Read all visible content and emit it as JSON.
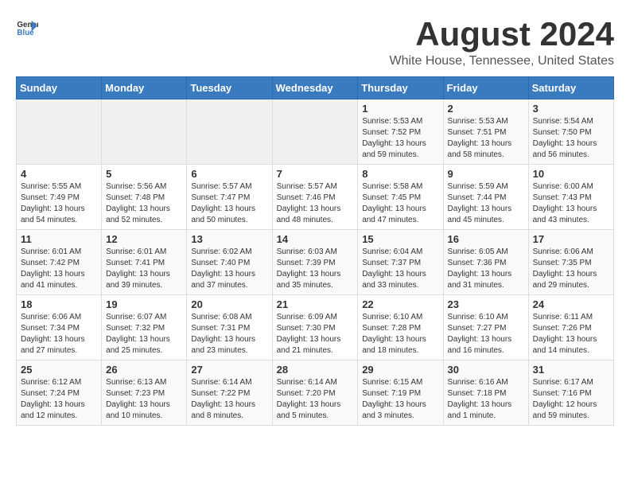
{
  "header": {
    "logo_general": "General",
    "logo_blue": "Blue",
    "main_title": "August 2024",
    "subtitle": "White House, Tennessee, United States"
  },
  "calendar": {
    "days_of_week": [
      "Sunday",
      "Monday",
      "Tuesday",
      "Wednesday",
      "Thursday",
      "Friday",
      "Saturday"
    ],
    "weeks": [
      [
        {
          "day": "",
          "info": ""
        },
        {
          "day": "",
          "info": ""
        },
        {
          "day": "",
          "info": ""
        },
        {
          "day": "",
          "info": ""
        },
        {
          "day": "1",
          "info": "Sunrise: 5:53 AM\nSunset: 7:52 PM\nDaylight: 13 hours\nand 59 minutes."
        },
        {
          "day": "2",
          "info": "Sunrise: 5:53 AM\nSunset: 7:51 PM\nDaylight: 13 hours\nand 58 minutes."
        },
        {
          "day": "3",
          "info": "Sunrise: 5:54 AM\nSunset: 7:50 PM\nDaylight: 13 hours\nand 56 minutes."
        }
      ],
      [
        {
          "day": "4",
          "info": "Sunrise: 5:55 AM\nSunset: 7:49 PM\nDaylight: 13 hours\nand 54 minutes."
        },
        {
          "day": "5",
          "info": "Sunrise: 5:56 AM\nSunset: 7:48 PM\nDaylight: 13 hours\nand 52 minutes."
        },
        {
          "day": "6",
          "info": "Sunrise: 5:57 AM\nSunset: 7:47 PM\nDaylight: 13 hours\nand 50 minutes."
        },
        {
          "day": "7",
          "info": "Sunrise: 5:57 AM\nSunset: 7:46 PM\nDaylight: 13 hours\nand 48 minutes."
        },
        {
          "day": "8",
          "info": "Sunrise: 5:58 AM\nSunset: 7:45 PM\nDaylight: 13 hours\nand 47 minutes."
        },
        {
          "day": "9",
          "info": "Sunrise: 5:59 AM\nSunset: 7:44 PM\nDaylight: 13 hours\nand 45 minutes."
        },
        {
          "day": "10",
          "info": "Sunrise: 6:00 AM\nSunset: 7:43 PM\nDaylight: 13 hours\nand 43 minutes."
        }
      ],
      [
        {
          "day": "11",
          "info": "Sunrise: 6:01 AM\nSunset: 7:42 PM\nDaylight: 13 hours\nand 41 minutes."
        },
        {
          "day": "12",
          "info": "Sunrise: 6:01 AM\nSunset: 7:41 PM\nDaylight: 13 hours\nand 39 minutes."
        },
        {
          "day": "13",
          "info": "Sunrise: 6:02 AM\nSunset: 7:40 PM\nDaylight: 13 hours\nand 37 minutes."
        },
        {
          "day": "14",
          "info": "Sunrise: 6:03 AM\nSunset: 7:39 PM\nDaylight: 13 hours\nand 35 minutes."
        },
        {
          "day": "15",
          "info": "Sunrise: 6:04 AM\nSunset: 7:37 PM\nDaylight: 13 hours\nand 33 minutes."
        },
        {
          "day": "16",
          "info": "Sunrise: 6:05 AM\nSunset: 7:36 PM\nDaylight: 13 hours\nand 31 minutes."
        },
        {
          "day": "17",
          "info": "Sunrise: 6:06 AM\nSunset: 7:35 PM\nDaylight: 13 hours\nand 29 minutes."
        }
      ],
      [
        {
          "day": "18",
          "info": "Sunrise: 6:06 AM\nSunset: 7:34 PM\nDaylight: 13 hours\nand 27 minutes."
        },
        {
          "day": "19",
          "info": "Sunrise: 6:07 AM\nSunset: 7:32 PM\nDaylight: 13 hours\nand 25 minutes."
        },
        {
          "day": "20",
          "info": "Sunrise: 6:08 AM\nSunset: 7:31 PM\nDaylight: 13 hours\nand 23 minutes."
        },
        {
          "day": "21",
          "info": "Sunrise: 6:09 AM\nSunset: 7:30 PM\nDaylight: 13 hours\nand 21 minutes."
        },
        {
          "day": "22",
          "info": "Sunrise: 6:10 AM\nSunset: 7:28 PM\nDaylight: 13 hours\nand 18 minutes."
        },
        {
          "day": "23",
          "info": "Sunrise: 6:10 AM\nSunset: 7:27 PM\nDaylight: 13 hours\nand 16 minutes."
        },
        {
          "day": "24",
          "info": "Sunrise: 6:11 AM\nSunset: 7:26 PM\nDaylight: 13 hours\nand 14 minutes."
        }
      ],
      [
        {
          "day": "25",
          "info": "Sunrise: 6:12 AM\nSunset: 7:24 PM\nDaylight: 13 hours\nand 12 minutes."
        },
        {
          "day": "26",
          "info": "Sunrise: 6:13 AM\nSunset: 7:23 PM\nDaylight: 13 hours\nand 10 minutes."
        },
        {
          "day": "27",
          "info": "Sunrise: 6:14 AM\nSunset: 7:22 PM\nDaylight: 13 hours\nand 8 minutes."
        },
        {
          "day": "28",
          "info": "Sunrise: 6:14 AM\nSunset: 7:20 PM\nDaylight: 13 hours\nand 5 minutes."
        },
        {
          "day": "29",
          "info": "Sunrise: 6:15 AM\nSunset: 7:19 PM\nDaylight: 13 hours\nand 3 minutes."
        },
        {
          "day": "30",
          "info": "Sunrise: 6:16 AM\nSunset: 7:18 PM\nDaylight: 13 hours\nand 1 minute."
        },
        {
          "day": "31",
          "info": "Sunrise: 6:17 AM\nSunset: 7:16 PM\nDaylight: 12 hours\nand 59 minutes."
        }
      ]
    ]
  }
}
